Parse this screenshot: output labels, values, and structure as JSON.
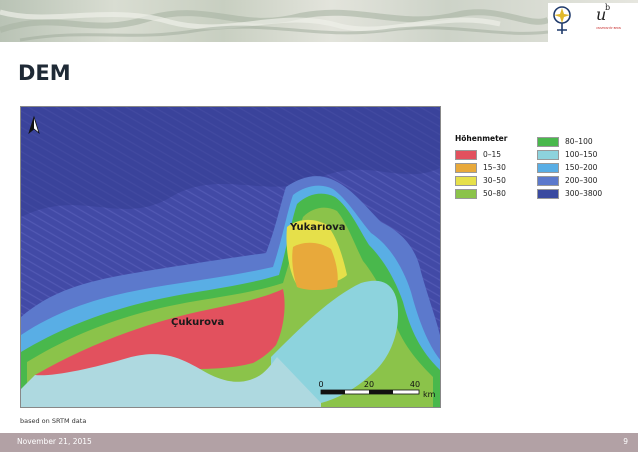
{
  "header": {
    "logo": {
      "icon": "university-emblem-icon",
      "mark_u": "u",
      "mark_b": "b",
      "text": "UNIVERSITÄT BERN"
    }
  },
  "title": "DEM",
  "map": {
    "labels": {
      "region_1": "Yukarıova",
      "region_2": "Çukurova"
    },
    "north_icon": "north-arrow-icon",
    "scale_bar": {
      "ticks": [
        "0",
        "20",
        "40"
      ],
      "unit": "km"
    }
  },
  "legend": {
    "title": "Höhenmeter",
    "items": [
      {
        "label": "0–15",
        "color": "#e2515e"
      },
      {
        "label": "15–30",
        "color": "#e8a93b"
      },
      {
        "label": "30–50",
        "color": "#e6e04a"
      },
      {
        "label": "50–80",
        "color": "#8bc34a"
      },
      {
        "label": "80–100",
        "color": "#49b84c"
      },
      {
        "label": "100–150",
        "color": "#8dd3dd"
      },
      {
        "label": "150–200",
        "color": "#59aee5"
      },
      {
        "label": "200–300",
        "color": "#5c79cc"
      },
      {
        "label": "300–3800",
        "color": "#3a4aa0"
      }
    ]
  },
  "caption": "based on SRTM data",
  "footer": {
    "date": "November 21, 2015",
    "page": "9"
  }
}
